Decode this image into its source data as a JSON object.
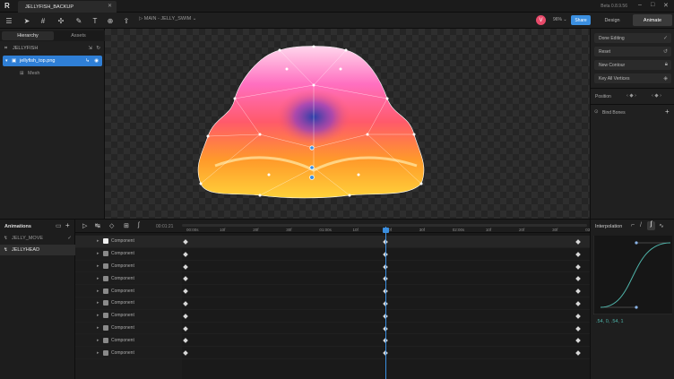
{
  "app": {
    "logo": "R",
    "tab_title": "JELLYFISH_BACKUP",
    "version": "Beta 0.8.9.56"
  },
  "toolbar": {
    "breadcrumb": "MAIN - JELLY_SWIM",
    "avatar_letter": "V",
    "zoom": "96% ⌄",
    "share": "Share",
    "mode_design": "Design",
    "mode_animate": "Animate"
  },
  "left_panel": {
    "tabs": [
      "Hierarchy",
      "Assets"
    ],
    "root": "JELLYFISH",
    "selected_item": "jellyfish_top.png",
    "child": "Mesh"
  },
  "right_panel": {
    "buttons": [
      "Done Editing",
      "Reset",
      "New Contour",
      "Key All Vertices"
    ],
    "position_label": "Position",
    "bones_label": "Bind Bones"
  },
  "animations": {
    "title": "Animations",
    "items": [
      "JELLY_MOVE",
      "JELLYHEAD"
    ]
  },
  "timeline": {
    "time": "00:01:21",
    "ticks": [
      "00:00s",
      "10f",
      "20f",
      "30f",
      "01:00s",
      "10f",
      "20f",
      "30f",
      "02:00s",
      "10f",
      "20f",
      "30f",
      "03:00s"
    ],
    "row_label": "Component"
  },
  "interpolation": {
    "title": "Interpolation",
    "values": ".54, 0, .54, 1"
  },
  "colors": {
    "accent": "#3b8fe0",
    "selection": "#2f7fd6",
    "curve": "#4fb3a9"
  }
}
